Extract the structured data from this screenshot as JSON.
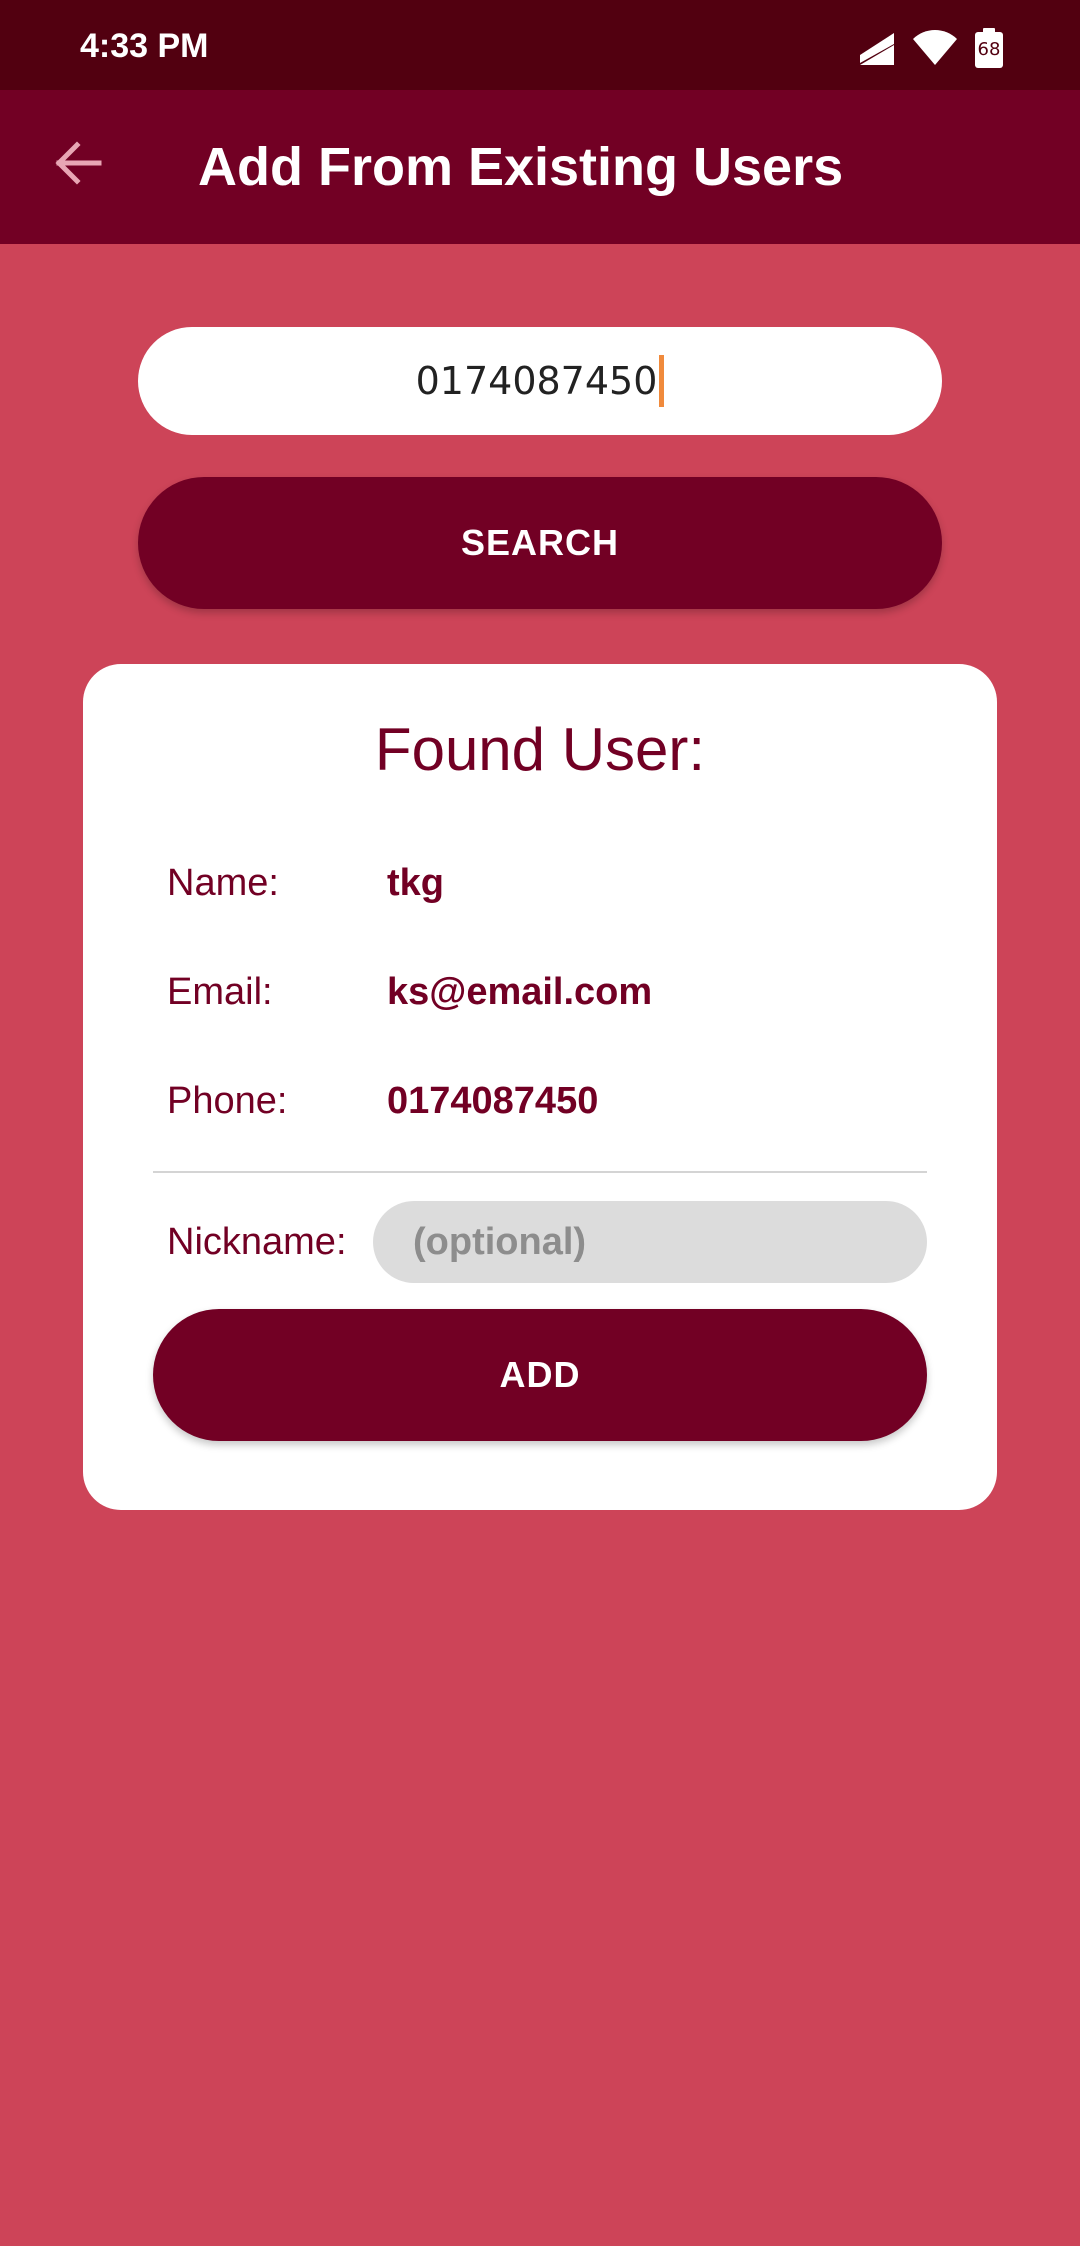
{
  "status_bar": {
    "time": "4:33 PM",
    "battery_level": "68",
    "icons": [
      "signal-icon",
      "wifi-icon",
      "battery-icon"
    ]
  },
  "app_bar": {
    "title": "Add From Existing Users",
    "back_icon": "arrow-back-icon"
  },
  "search": {
    "value": "0174087450",
    "button_label": "SEARCH"
  },
  "result_card": {
    "title": "Found User:",
    "fields": [
      {
        "label": "Name:",
        "value": "tkg"
      },
      {
        "label": "Email:",
        "value": "ks@email.com"
      },
      {
        "label": "Phone:",
        "value": "0174087450"
      }
    ],
    "nickname": {
      "label": "Nickname:",
      "placeholder": "(optional)",
      "value": ""
    },
    "add_label": "ADD"
  },
  "colors": {
    "status_bar": "#520010",
    "app_bar": "#720024",
    "background": "#cd4458",
    "accent": "#720024",
    "caret": "#f08a3c"
  }
}
